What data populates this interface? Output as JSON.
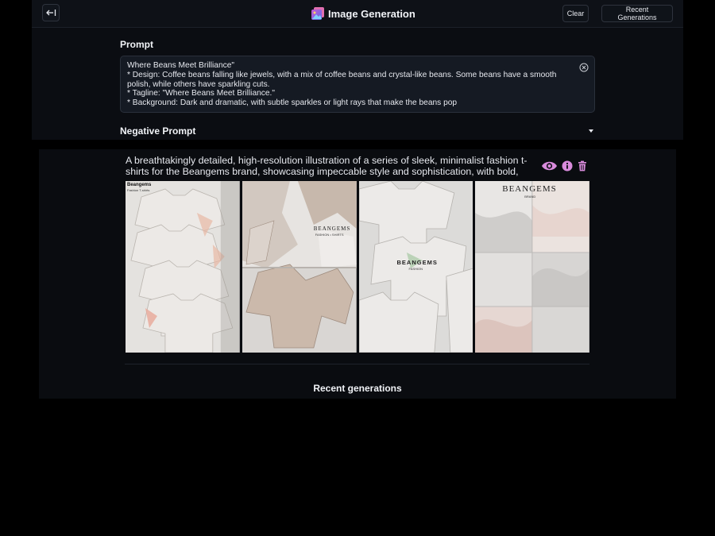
{
  "header": {
    "title": "Image Generation",
    "clear_label": "Clear",
    "recent_label": "Recent Generations",
    "back_icon": "collapse-left-icon",
    "app_icon": "image-gallery-icon"
  },
  "form": {
    "prompt_label": "Prompt",
    "prompt_value": "Where Beans Meet Brilliance\"\n* Design: Coffee beans falling like jewels, with a mix of coffee beans and crystal-like beans. Some beans have a smooth polish, while others have sparkling cuts.\n* Tagline: \"Where Beans Meet Brilliance.\"\n* Background: Dark and dramatic, with subtle sparkles or light rays that make the beans pop",
    "negative_label": "Negative Prompt"
  },
  "result": {
    "description": "A breathtakingly detailed, high-resolution illustration of a series of sleek, minimalist fashion t-shirts for the Beangems brand, showcasing impeccable style and sophistication, with bold, modern typ...",
    "actions": [
      "eye-icon",
      "info-icon",
      "trash-icon"
    ],
    "accent_color": "#d98bdc",
    "images": [
      {
        "brand": "Beangems",
        "tag": "Fashion T-shirts"
      },
      {
        "brand": "BEANGEMS",
        "tag": "FASHION • SHIRTS"
      },
      {
        "brand": "BEANGEMS",
        "tag": "FASHION"
      },
      {
        "brand": "BEANGEMS",
        "tag": "BRAND"
      }
    ]
  },
  "recent_title": "Recent generations"
}
